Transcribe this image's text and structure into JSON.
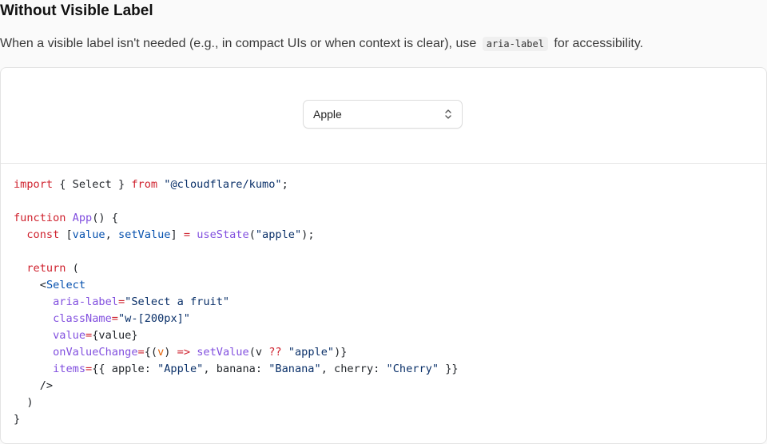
{
  "section": {
    "title": "Without Visible Label",
    "desc_before": "When a visible label isn't needed (e.g., in compact UIs or when context is clear), use",
    "desc_code": "aria-label",
    "desc_after": "for accessibility."
  },
  "preview": {
    "select": {
      "value": "Apple",
      "icon": "chevron-up-down-icon"
    }
  },
  "code": {
    "kw_import": "import",
    "import_braces": " { Select } ",
    "kw_from": "from",
    "import_path": "\"@cloudflare/kumo\"",
    "semicolon": ";",
    "kw_function": "function",
    "fn_name": "App",
    "fn_open": "() {",
    "kw_const": "const",
    "destructure_open": " [",
    "var_value": "value",
    "comma": ", ",
    "var_setValue": "setValue",
    "destructure_close": "] ",
    "op_eq": "=",
    "fn_useState": "useState",
    "paren_open": "(",
    "state_init": "\"apple\"",
    "paren_close_semi": ");",
    "kw_return": "return",
    "return_paren": " (",
    "lt": "<",
    "tag_select": "Select",
    "attr_aria": "aria-label",
    "eq": "=",
    "aria_value": "\"Select a fruit\"",
    "attr_class": "className",
    "class_value": "\"w-[200px]\"",
    "attr_value": "value",
    "value_expr": "{value}",
    "attr_onchange": "onValueChange",
    "onchange_open": "{(",
    "param_v": "v",
    "onchange_mid": ") ",
    "arrow": "=>",
    "space": " ",
    "fn_setValue": "setValue",
    "onchange_arg": "(v ",
    "nullish": "??",
    "fallback": "\"apple\"",
    "onchange_close": ")}",
    "attr_items": "items",
    "items_open": "{{ apple: ",
    "item_apple": "\"Apple\"",
    "items_banana_key": ", banana: ",
    "item_banana": "\"Banana\"",
    "items_cherry_key": ", cherry: ",
    "item_cherry": "\"Cherry\"",
    "items_close": " }}",
    "self_close": "/>",
    "close_paren": ")",
    "close_brace": "}"
  },
  "colors": {
    "keyword": "#cf222e",
    "function": "#8250df",
    "string": "#0a3069",
    "tag": "#0550ae"
  }
}
